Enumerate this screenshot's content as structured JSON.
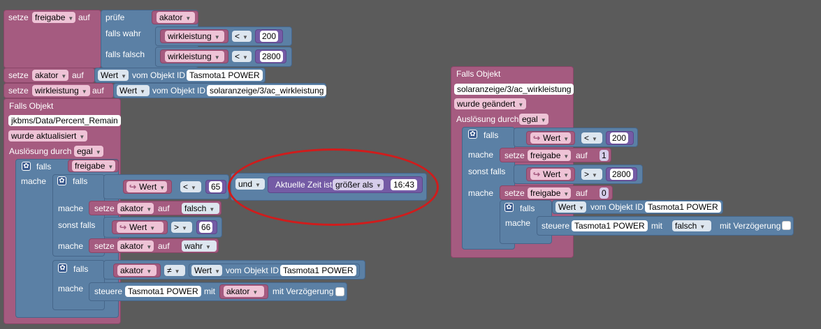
{
  "labels": {
    "setze": "setze",
    "auf": "auf",
    "pruefe": "prüfe",
    "falls_wahr": "falls wahr",
    "falls_falsch": "falls falsch",
    "vom_objekt_id": "vom Objekt ID",
    "falls_objekt": "Falls Objekt",
    "ausloesung_durch": "Auslösung durch",
    "falls": "falls",
    "mache": "mache",
    "sonst_falls": "sonst falls",
    "steuere": "steuere",
    "mit": "mit",
    "mit_verzoegerung": "mit Verzögerung",
    "aktuelle_zeit_ist": "Aktuelle Zeit ist",
    "arrow": "↪"
  },
  "vars": {
    "freigabe": "freigabe",
    "akator": "akator",
    "wirkleistung": "wirkleistung",
    "wert": "Wert"
  },
  "ops": {
    "lt": "<",
    "gt": ">",
    "ne": "≠",
    "und": "und",
    "groesser_als": "größer als"
  },
  "values": {
    "n200": "200",
    "n2800": "2800",
    "n65": "65",
    "n66": "66",
    "n1": "1",
    "n0": "0",
    "time": "16:43",
    "falsch": "falsch",
    "wahr": "wahr"
  },
  "objects": {
    "tasmota": "Tasmota1 POWER",
    "solar": "solaranzeige/3/ac_wirkleistung",
    "jkbms": "jkbms/Data/Percent_Remain"
  },
  "events": {
    "aktualisiert": "wurde aktualisiert",
    "geaendert": "wurde geändert",
    "egal": "egal"
  }
}
